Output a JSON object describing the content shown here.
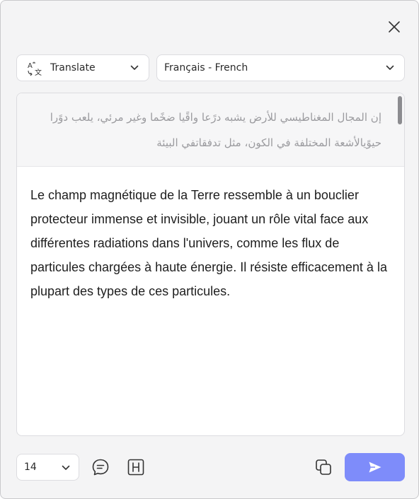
{
  "header": {
    "close_icon": "close-icon"
  },
  "mode_dropdown": {
    "icon": "translate-icon",
    "label": "Translate"
  },
  "language_dropdown": {
    "label": "Français - French"
  },
  "source": {
    "text": "إن المجال المغناطيسي للأرض يشبه درًعا واقًيا ضخًما وغير مرئي، يلعب دوًرا حيوًيالأشعة المختلفة في الكون، مثل تدفقاتفي البيئة"
  },
  "result": {
    "text": "Le champ magnétique de la Terre ressemble à un bouclier protecteur immense et invisible, jouant un rôle vital face aux différentes radiations dans l'univers, comme les flux de particules chargées à haute énergie. Il résiste efficacement à la plupart des types de ces particules."
  },
  "footer": {
    "font_size": "14",
    "comment_icon": "comment-icon",
    "heading_icon": "heading-icon",
    "copy_icon": "copy-icon",
    "send_icon": "send-icon"
  },
  "colors": {
    "accent": "#7e8cfa",
    "background": "#f4f4f5"
  }
}
